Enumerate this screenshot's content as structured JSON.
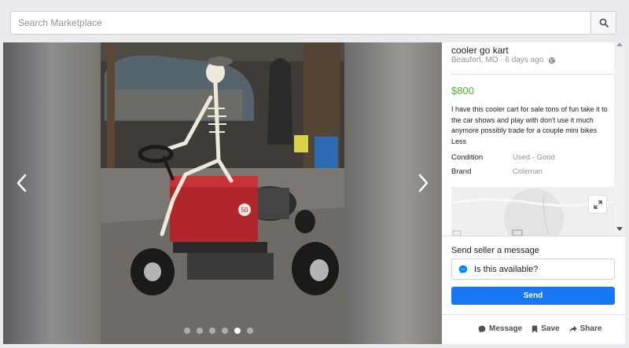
{
  "search": {
    "placeholder": "Search Marketplace"
  },
  "listing": {
    "title": "cooler go kart",
    "location_time": "Beaufort, MO · 6 days ago",
    "price": "$800",
    "description": "I have this cooler cart for sale tons of fun take it to the car shows and play with don't use it much anymore possibly trade for a couple mini bikes",
    "less_label": "Less",
    "attributes": [
      {
        "key": "Condition",
        "value": "Used - Good"
      },
      {
        "key": "Brand",
        "value": "Coleman"
      }
    ]
  },
  "message": {
    "label": "Send seller a message",
    "input_value": "Is this available?",
    "send_label": "Send"
  },
  "actions": {
    "message_label": "Message",
    "save_label": "Save",
    "share_label": "Share"
  },
  "photo": {
    "count": 6,
    "active_index": 4,
    "cooler_badge": "50"
  },
  "icons": [
    "search-icon",
    "globe-icon",
    "chevron-left-icon",
    "chevron-right-icon",
    "expand-icon",
    "messenger-icon",
    "message-icon",
    "bookmark-icon",
    "share-icon"
  ],
  "colors": {
    "price": "#42b72a",
    "send_button": "#1877f2",
    "messenger": "#0084ff"
  }
}
